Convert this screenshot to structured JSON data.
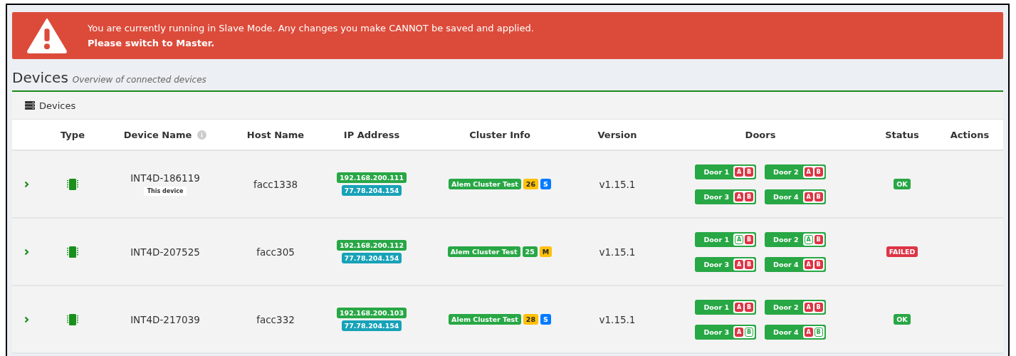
{
  "alert": {
    "message": "You are currently running in Slave Mode. Any changes you make CANNOT be saved and applied.",
    "emphasis": "Please switch to Master."
  },
  "page": {
    "title": "Devices",
    "subtitle": "Overview of connected devices"
  },
  "panel": {
    "title": "Devices"
  },
  "table": {
    "columns": [
      "Type",
      "Device Name",
      "Host Name",
      "IP Address",
      "Cluster Info",
      "Version",
      "Doors",
      "Status",
      "Actions"
    ],
    "rows": [
      {
        "name": "INT4D-186119",
        "tag": "This device",
        "host": "facc1338",
        "ips": [
          "192.168.200.111",
          "77.78.204.154"
        ],
        "cluster": {
          "name": "Alem Cluster Test",
          "count": {
            "label": "26",
            "color": "#ffc107"
          },
          "role": {
            "label": "S",
            "color": "#007bff"
          }
        },
        "version": "v1.15.1",
        "doors": [
          {
            "label": "Door 1",
            "locks": [
              {
                "label": "A",
                "alarm": true
              },
              {
                "label": "B",
                "alarm": true
              }
            ]
          },
          {
            "label": "Door 2",
            "locks": [
              {
                "label": "A",
                "alarm": true
              },
              {
                "label": "B",
                "alarm": true
              }
            ]
          },
          {
            "label": "Door 3",
            "locks": [
              {
                "label": "A",
                "alarm": true
              },
              {
                "label": "B",
                "alarm": true
              }
            ]
          },
          {
            "label": "Door 4",
            "locks": [
              {
                "label": "A",
                "alarm": true
              },
              {
                "label": "B",
                "alarm": true
              }
            ]
          }
        ],
        "status": {
          "label": "OK",
          "color": "#28a745"
        }
      },
      {
        "name": "INT4D-207525",
        "host": "facc305",
        "ips": [
          "192.168.200.112",
          "77.78.204.154"
        ],
        "cluster": {
          "name": "Alem Cluster Test",
          "count": {
            "label": "25",
            "color": "#28a745"
          },
          "role": {
            "label": "M",
            "color": "#ffc107"
          }
        },
        "version": "v1.15.1",
        "doors": [
          {
            "label": "Door 1",
            "locks": [
              {
                "label": "A",
                "alarm": false
              },
              {
                "label": "B",
                "alarm": true
              }
            ]
          },
          {
            "label": "Door 2",
            "locks": [
              {
                "label": "A",
                "alarm": false
              },
              {
                "label": "B",
                "alarm": true
              }
            ]
          },
          {
            "label": "Door 3",
            "locks": [
              {
                "label": "A",
                "alarm": true
              },
              {
                "label": "B",
                "alarm": true
              }
            ]
          },
          {
            "label": "Door 4",
            "locks": [
              {
                "label": "A",
                "alarm": true
              },
              {
                "label": "B",
                "alarm": true
              }
            ]
          }
        ],
        "status": {
          "label": "FAILED",
          "color": "#dc3545"
        }
      },
      {
        "name": "INT4D-217039",
        "host": "facc332",
        "ips": [
          "192.168.200.103",
          "77.78.204.154"
        ],
        "cluster": {
          "name": "Alem Cluster Test",
          "count": {
            "label": "28",
            "color": "#ffc107"
          },
          "role": {
            "label": "S",
            "color": "#007bff"
          }
        },
        "version": "v1.15.1",
        "doors": [
          {
            "label": "Door 1",
            "locks": [
              {
                "label": "A",
                "alarm": true
              },
              {
                "label": "B",
                "alarm": true
              }
            ]
          },
          {
            "label": "Door 2",
            "locks": [
              {
                "label": "A",
                "alarm": true
              },
              {
                "label": "B",
                "alarm": true
              }
            ]
          },
          {
            "label": "Door 3",
            "locks": [
              {
                "label": "A",
                "alarm": true
              },
              {
                "label": "B",
                "alarm": false
              }
            ]
          },
          {
            "label": "Door 4",
            "locks": [
              {
                "label": "A",
                "alarm": true
              },
              {
                "label": "B",
                "alarm": false
              }
            ]
          }
        ],
        "status": {
          "label": "OK",
          "color": "#28a745"
        }
      }
    ]
  }
}
